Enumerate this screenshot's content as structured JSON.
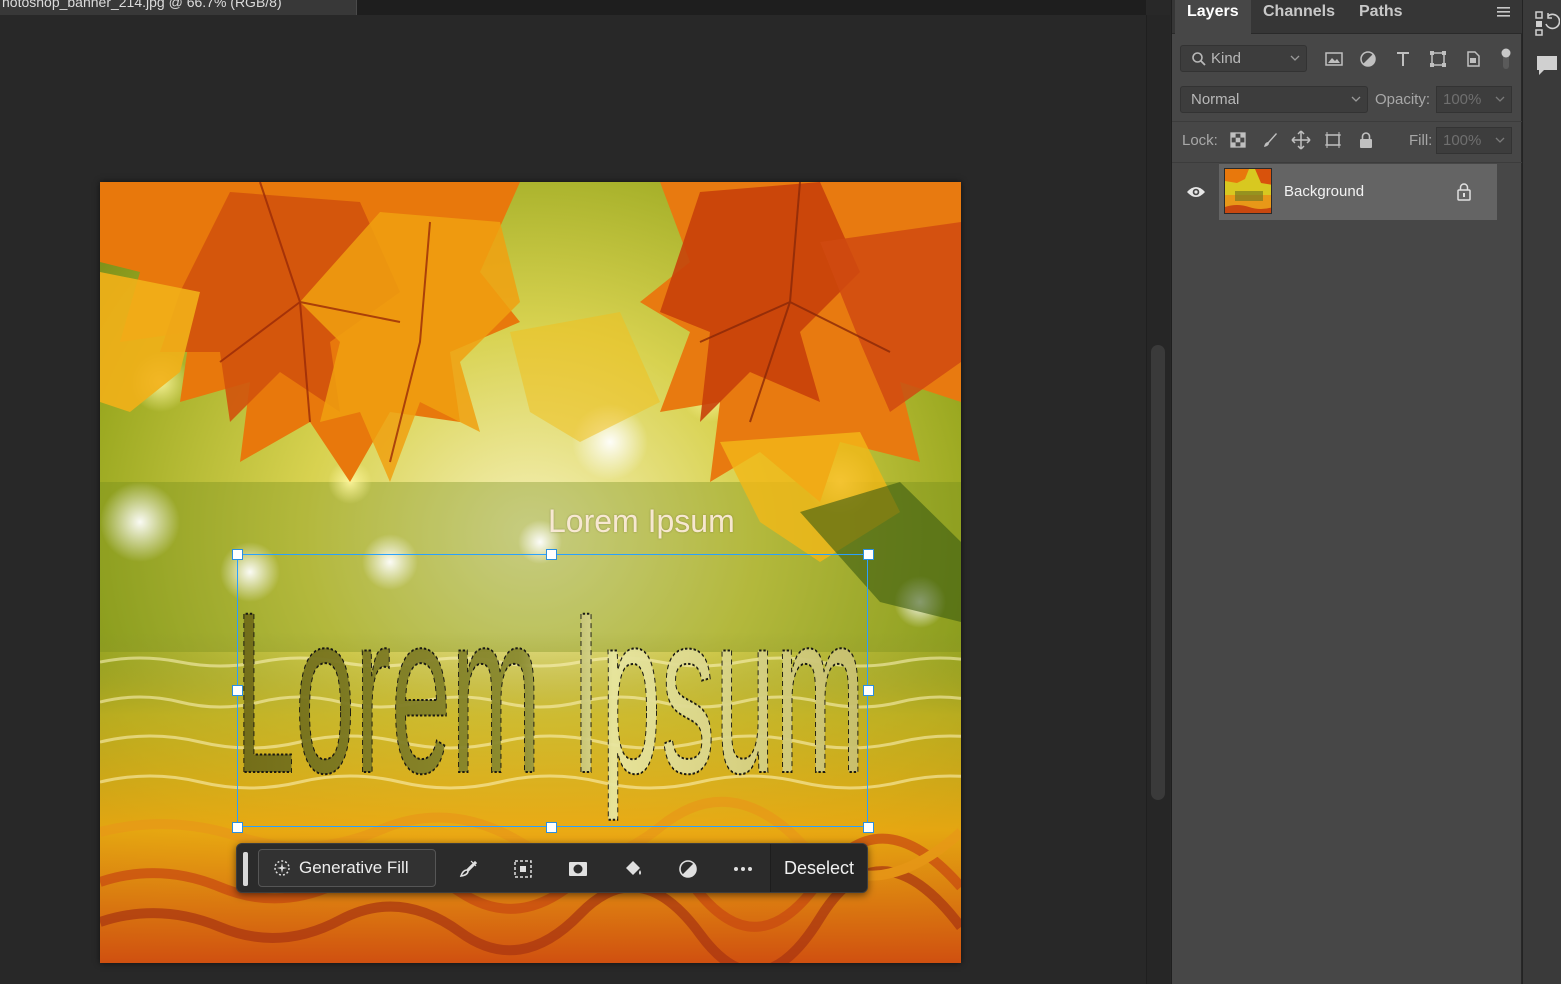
{
  "document": {
    "tab_title": "hotoshop_banner_214.jpg @ 66.7% (RGB/8)"
  },
  "canvas": {
    "caption_text": "Lorem Ipsum",
    "selection_text": "Lorem Ipsum"
  },
  "taskbar": {
    "generative_fill_label": "Generative Fill",
    "deselect_label": "Deselect",
    "icons": [
      "brush-icon",
      "transform-selection-icon",
      "mask-icon",
      "fill-bucket-icon",
      "adjustment-icon",
      "more-options-icon"
    ]
  },
  "layers_panel": {
    "tabs": [
      {
        "label": "Layers",
        "active": true
      },
      {
        "label": "Channels",
        "active": false
      },
      {
        "label": "Paths",
        "active": false
      }
    ],
    "filter_kind": "Kind",
    "filter_icons": [
      "image-filter-icon",
      "adjustment-filter-icon",
      "type-filter-icon",
      "shape-filter-icon",
      "smart-object-filter-icon"
    ],
    "blend_mode": "Normal",
    "opacity_label": "Opacity:",
    "opacity_value": "100%",
    "lock_label": "Lock:",
    "lock_icons": [
      "lock-transparent-icon",
      "lock-image-icon",
      "lock-position-icon",
      "lock-artboard-icon",
      "lock-all-icon"
    ],
    "fill_label": "Fill:",
    "fill_value": "100%",
    "layers": [
      {
        "name": "Background",
        "visible": true,
        "locked": true
      }
    ]
  },
  "colors": {
    "accent": "#2aa0ff",
    "panel_bg": "#474747",
    "canvas_bg": "#282828"
  }
}
